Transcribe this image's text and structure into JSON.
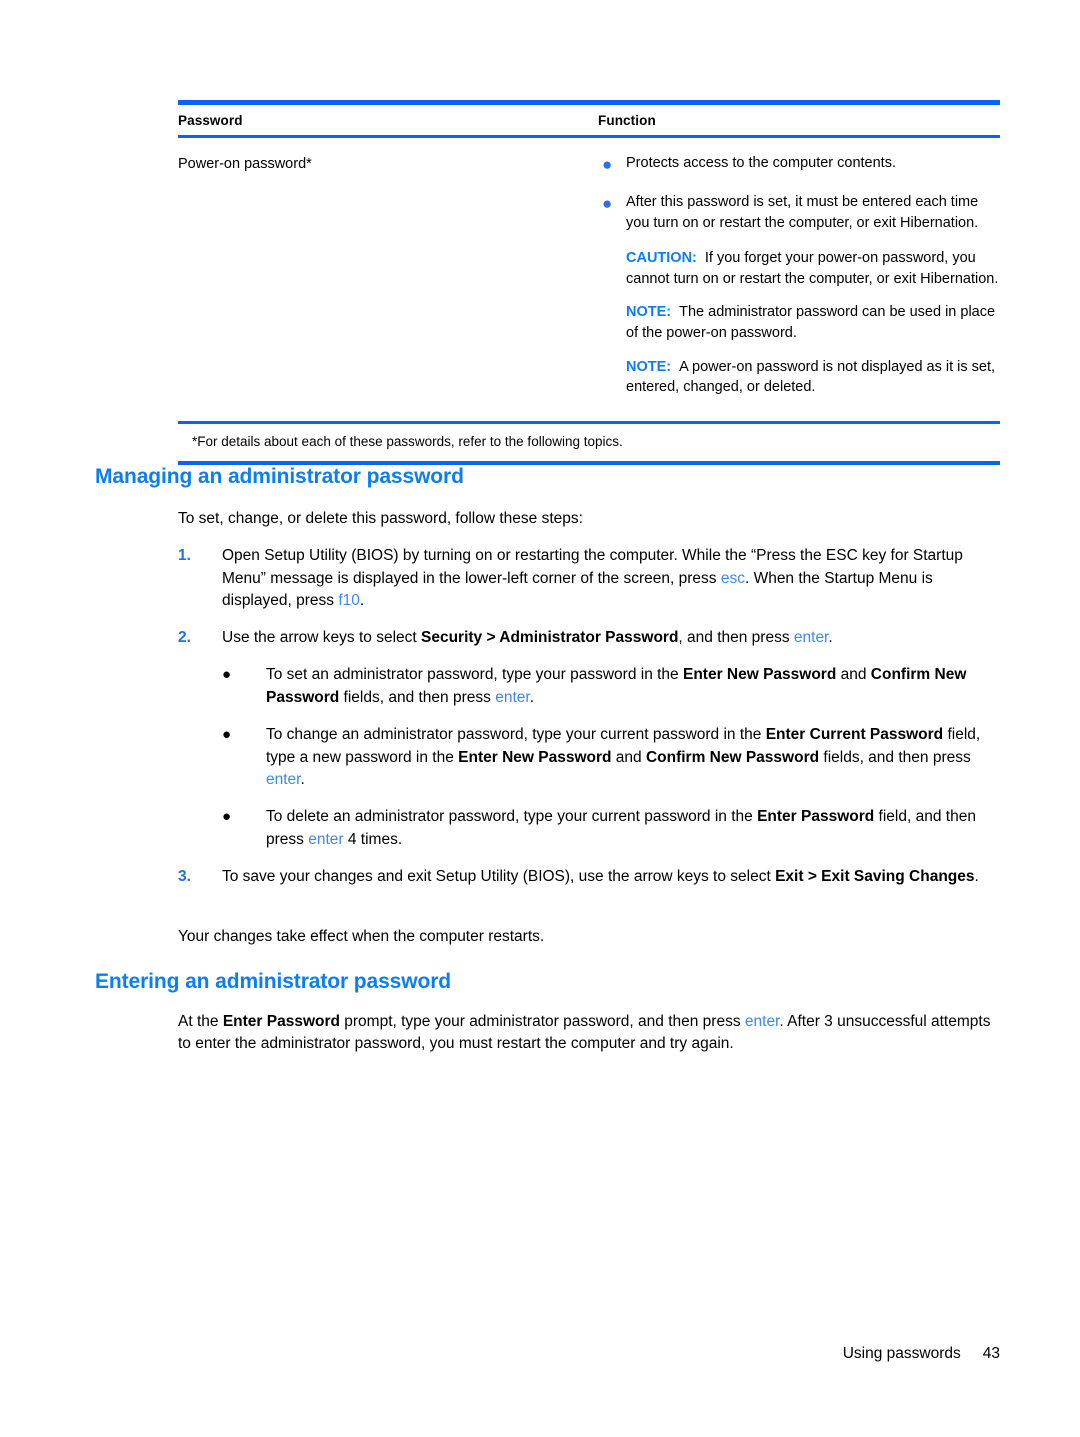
{
  "document": {
    "table": {
      "headers": [
        "Password",
        "Function"
      ],
      "row": {
        "password": "Power-on password*",
        "bullets": [
          "Protects access to the computer contents.",
          "After this password is set, it must be entered each time you turn on or restart the computer, or exit Hibernation."
        ],
        "notices": [
          {
            "label": "CAUTION:",
            "text": "If you forget your power-on password, you cannot turn on or restart the computer, or exit Hibernation."
          },
          {
            "label": "NOTE:",
            "text": "The administrator password can be used in place of the power-on password."
          },
          {
            "label": "NOTE:",
            "text": "A power-on password is not displayed as it is set, entered, changed, or deleted."
          }
        ]
      },
      "footnote": "*For details about each of these passwords, refer to the following topics."
    },
    "sections": [
      {
        "heading": "Managing an administrator password",
        "intro": "To set, change, or delete this password, follow these steps:",
        "steps": [
          {
            "number": "1.",
            "text_parts": [
              {
                "t": "Open Setup Utility (BIOS) by turning on or restarting the computer. While the “Press the ESC key for Startup Menu” message is displayed in the lower-left corner of the screen, press ",
                "s": "normal"
              },
              {
                "t": "esc",
                "s": "key"
              },
              {
                "t": ". When the Startup Menu is displayed, press ",
                "s": "normal"
              },
              {
                "t": "f10",
                "s": "key"
              },
              {
                "t": ".",
                "s": "normal"
              }
            ]
          },
          {
            "number": "2.",
            "text_parts": [
              {
                "t": "Use the arrow keys to select ",
                "s": "normal"
              },
              {
                "t": "Security > Administrator Password",
                "s": "bold"
              },
              {
                "t": ", and then press ",
                "s": "normal"
              },
              {
                "t": "enter",
                "s": "key"
              },
              {
                "t": ".",
                "s": "normal"
              }
            ]
          }
        ],
        "bullets": [
          {
            "text_parts": [
              {
                "t": "To set an administrator password, type your password in the ",
                "s": "normal"
              },
              {
                "t": "Enter New Password",
                "s": "bold"
              },
              {
                "t": " and ",
                "s": "normal"
              },
              {
                "t": "Confirm New Password",
                "s": "bold"
              },
              {
                "t": " fields, and then press ",
                "s": "normal"
              },
              {
                "t": "enter",
                "s": "key"
              },
              {
                "t": ".",
                "s": "normal"
              }
            ]
          },
          {
            "text_parts": [
              {
                "t": "To change an administrator password, type your current password in the ",
                "s": "normal"
              },
              {
                "t": "Enter Current Password",
                "s": "bold"
              },
              {
                "t": " field, type a new password in the ",
                "s": "normal"
              },
              {
                "t": "Enter New Password",
                "s": "bold"
              },
              {
                "t": " and ",
                "s": "normal"
              },
              {
                "t": "Confirm New Password",
                "s": "bold"
              },
              {
                "t": " fields, and then press ",
                "s": "normal"
              },
              {
                "t": "enter",
                "s": "key"
              },
              {
                "t": ".",
                "s": "normal"
              }
            ]
          },
          {
            "text_parts": [
              {
                "t": "To delete an administrator password, type your current password in the ",
                "s": "normal"
              },
              {
                "t": "Enter Password",
                "s": "bold"
              },
              {
                "t": " field, and then press ",
                "s": "normal"
              },
              {
                "t": "enter",
                "s": "key"
              },
              {
                "t": " 4 times.",
                "s": "normal"
              }
            ]
          }
        ],
        "step3": {
          "number": "3.",
          "text_parts": [
            {
              "t": "To save your changes and exit Setup Utility (BIOS), use the arrow keys to select ",
              "s": "normal"
            },
            {
              "t": "Exit > Exit Saving Changes",
              "s": "bold"
            },
            {
              "t": ".",
              "s": "normal"
            }
          ]
        },
        "closing": "Your changes take effect when the computer restarts."
      },
      {
        "heading": "Entering an administrator password",
        "paragraph_parts": [
          {
            "t": "At the ",
            "s": "normal"
          },
          {
            "t": "Enter Password",
            "s": "bold"
          },
          {
            "t": " prompt, type your administrator password, and then press ",
            "s": "normal"
          },
          {
            "t": "enter",
            "s": "key"
          },
          {
            "t": ". After 3 unsuccessful attempts to enter the administrator password, you must restart the computer and try again.",
            "s": "normal"
          }
        ]
      }
    ],
    "footer": {
      "title": "Using passwords",
      "page_number": "43"
    },
    "colors": {
      "rule_blue": "#0b63f6",
      "heading_blue": "#0b7ef5",
      "key_blue": "#3c87f0",
      "number_blue": "#1a73e8",
      "table_bullet_blue": "#2f6fe4"
    },
    "bullet_glyph": "●"
  }
}
